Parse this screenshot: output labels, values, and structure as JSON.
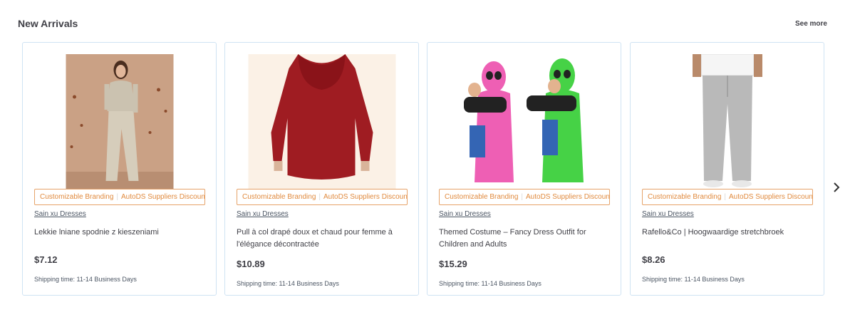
{
  "section": {
    "title": "New Arrivals",
    "see_more": "See more"
  },
  "products": [
    {
      "badge_1": "Customizable Branding",
      "badge_2": "AutoDS Suppliers Discoun...",
      "supplier": "Sain xu Dresses",
      "name": "Lekkie lniane spodnie z kieszeniami",
      "price": "$7.12",
      "shipping": "Shipping time: 11-14 Business Days"
    },
    {
      "badge_1": "Customizable Branding",
      "badge_2": "AutoDS Suppliers Discoun...",
      "supplier": "Sain xu Dresses",
      "name": "Pull à col drapé doux et chaud pour femme à l'élégance décontractée",
      "price": "$10.89",
      "shipping": "Shipping time: 11-14 Business Days"
    },
    {
      "badge_1": "Customizable Branding",
      "badge_2": "AutoDS Suppliers Discoun...",
      "supplier": "Sain xu Dresses",
      "name": "Themed Costume – Fancy Dress Outfit for Children and Adults",
      "price": "$15.29",
      "shipping": "Shipping time: 11-14 Business Days"
    },
    {
      "badge_1": "Customizable Branding",
      "badge_2": "AutoDS Suppliers Discoun...",
      "supplier": "Sain xu Dresses",
      "name": "Rafello&Co | Hoogwaardige stretchbroek",
      "price": "$8.26",
      "shipping": "Shipping time: 11-14 Business Days"
    }
  ],
  "icons": {
    "next": "chevron-right-icon"
  },
  "colors": {
    "card_border": "#cfe3f3",
    "badge": "#e08a3e",
    "text": "#3f3f46"
  }
}
